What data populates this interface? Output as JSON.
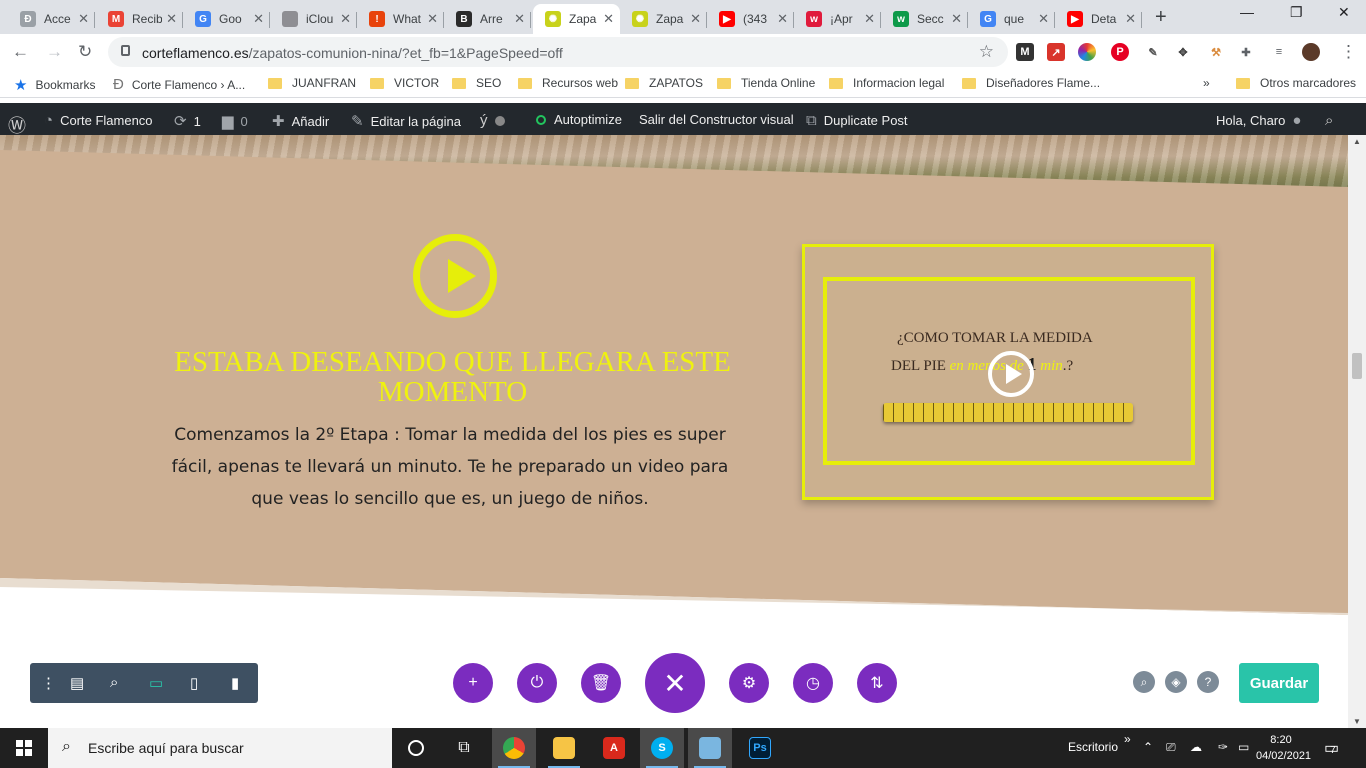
{
  "browser": {
    "tabs": [
      {
        "title": "Acce",
        "favicon_color": "#9aa0a6",
        "glyph": "Ð"
      },
      {
        "title": "Recib",
        "favicon_color": "#ea4335",
        "glyph": "M"
      },
      {
        "title": "Goo",
        "favicon_color": "#4285f4",
        "glyph": "G"
      },
      {
        "title": "iClou",
        "favicon_color": "#8e8e93",
        "glyph": ""
      },
      {
        "title": "What",
        "favicon_color": "#e8430c",
        "glyph": "!"
      },
      {
        "title": "Arre",
        "favicon_color": "#2b2b2b",
        "glyph": "B"
      },
      {
        "title": "Zapa",
        "favicon_color": "#c8d21b",
        "glyph": "✺"
      },
      {
        "title": "Zapa",
        "favicon_color": "#c8d21b",
        "glyph": "✺"
      },
      {
        "title": "(343",
        "favicon_color": "#ff0000",
        "glyph": "▶"
      },
      {
        "title": "¡Apr",
        "favicon_color": "#e01b3c",
        "glyph": "w"
      },
      {
        "title": "Secc",
        "favicon_color": "#0e9a4a",
        "glyph": "w"
      },
      {
        "title": "que",
        "favicon_color": "#4285f4",
        "glyph": "G"
      },
      {
        "title": "Deta",
        "favicon_color": "#ff0000",
        "glyph": "▶"
      }
    ],
    "url_domain": "corteflamenco.es",
    "url_path": "/zapatos-comunion-nina/?et_fb=1&PageSpeed=off",
    "bookmarks": [
      {
        "label": "Bookmarks",
        "icon": "star-icon"
      },
      {
        "label": "Corte Flamenco › A...",
        "icon": "site-icon"
      },
      {
        "label": "JUANFRAN",
        "icon": "folder-icon"
      },
      {
        "label": "VICTOR",
        "icon": "folder-icon"
      },
      {
        "label": "SEO",
        "icon": "folder-icon"
      },
      {
        "label": "Recursos web",
        "icon": "folder-icon"
      },
      {
        "label": "ZAPATOS",
        "icon": "folder-icon"
      },
      {
        "label": "Tienda Online",
        "icon": "folder-icon"
      },
      {
        "label": "Informacion legal",
        "icon": "folder-icon"
      },
      {
        "label": "Diseñadores Flame...",
        "icon": "folder-icon"
      }
    ],
    "bookmarks_more": "»",
    "other_bookmarks": "Otros marcadores"
  },
  "wp_admin": {
    "site_name": "Corte Flamenco",
    "updates_count": "1",
    "comments_count": "0",
    "add_new": "Añadir",
    "edit_page": "Editar la página",
    "autoptimize": "Autoptimize",
    "exit_builder": "Salir del Constructor visual",
    "duplicate_post": "Duplicate Post",
    "greeting": "Hola, Charo"
  },
  "content": {
    "headline": "ESTABA DESEANDO QUE LLEGARA ESTE MOMENTO",
    "body": "Comenzamos la 2º Etapa : Tomar la medida  del los pies es super fácil, apenas te llevará un minuto. Te he preparado un video para que veas lo sencillo que es, un juego de niños.",
    "video": {
      "title_line1": "¿COMO TOMAR LA MEDIDA",
      "title_line2_prefix": "DEL PIE ",
      "title_line2_highlight": "en menos de ",
      "title_line2_number": "1",
      "title_line2_unit": " min",
      "title_line2_suffix": ".?"
    },
    "accent_color": "#e6ee0a",
    "background_color": "#cdb094"
  },
  "divi": {
    "save_label": "Guardar",
    "primary_color": "#7b2cbf",
    "save_color": "#29c4a9"
  },
  "taskbar": {
    "search_placeholder": "Escribe aquí para buscar",
    "desktop_label": "Escritorio",
    "time": "8:20",
    "date": "04/02/2021",
    "notifications": "7"
  }
}
